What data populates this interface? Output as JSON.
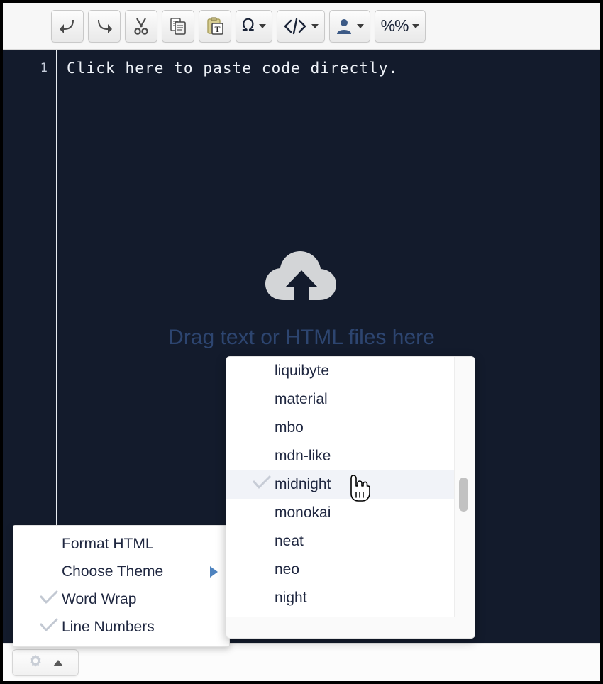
{
  "toolbar": {
    "buttons": [
      {
        "name": "undo-button",
        "icon": "undo-arrow-icon",
        "label": "",
        "has_caret": false
      },
      {
        "name": "redo-button",
        "icon": "redo-arrow-icon",
        "label": "",
        "has_caret": false
      },
      {
        "name": "cut-button",
        "icon": "scissors-icon",
        "label": "",
        "has_caret": false
      },
      {
        "name": "copy-button",
        "icon": "copy-documents-icon",
        "label": "",
        "has_caret": false
      },
      {
        "name": "paste-as-text-button",
        "icon": "clipboard-text-icon",
        "label": "",
        "has_caret": false
      },
      {
        "name": "special-chars-button",
        "icon": "omega-icon",
        "label": "Ω",
        "has_caret": true
      },
      {
        "name": "source-code-button",
        "icon": "code-tags-icon",
        "label": "",
        "has_caret": true
      },
      {
        "name": "user-button",
        "icon": "person-icon",
        "label": "",
        "has_caret": true
      },
      {
        "name": "percent-button",
        "icon": "percent-percent-icon",
        "label": "%%",
        "has_caret": true
      }
    ]
  },
  "editor": {
    "line_number": "1",
    "code_text": "Click here to paste code directly.",
    "dropzone": {
      "icon": "cloud-upload-icon",
      "text": "Drag text or HTML files here"
    },
    "background_color": "#131b2c",
    "text_color": "#eef2f8",
    "dropzone_text_color": "#2d4570"
  },
  "context_menu": {
    "items": [
      {
        "label": "Format HTML",
        "checked": false,
        "submenu": false
      },
      {
        "label": "Choose Theme",
        "checked": false,
        "submenu": true
      },
      {
        "label": "Word Wrap",
        "checked": true,
        "submenu": false
      },
      {
        "label": "Line Numbers",
        "checked": true,
        "submenu": false
      }
    ]
  },
  "theme_menu": {
    "items": [
      {
        "label": "liquibyte",
        "selected": false
      },
      {
        "label": "material",
        "selected": false
      },
      {
        "label": "mbo",
        "selected": false
      },
      {
        "label": "mdn-like",
        "selected": false
      },
      {
        "label": "midnight",
        "selected": true
      },
      {
        "label": "monokai",
        "selected": false
      },
      {
        "label": "neat",
        "selected": false
      },
      {
        "label": "neo",
        "selected": false
      },
      {
        "label": "night",
        "selected": false
      }
    ],
    "scrollbar_visible": true
  },
  "bottom_bar": {
    "settings_button": {
      "icon": "gear-icon",
      "caret": "caret-up-icon"
    }
  },
  "cursor": {
    "type": "pointing-hand-cursor"
  },
  "colors": {
    "accent_blue": "#4e83bf",
    "editor_bg": "#131b2c",
    "toolbar_bg": "#f7f7f7",
    "menu_bg": "#ffffff",
    "selected_row": "#f1f3f8"
  }
}
